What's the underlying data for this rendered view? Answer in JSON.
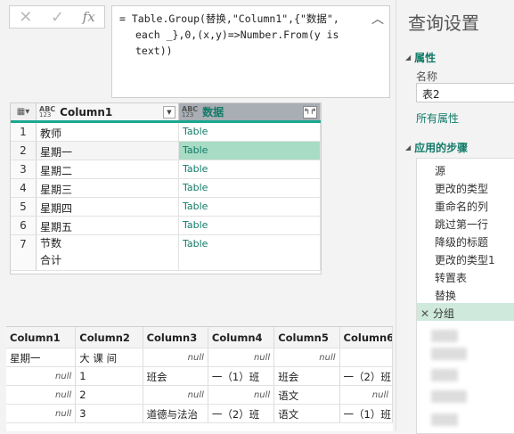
{
  "formula_bar": {
    "cancel_icon": "✕",
    "commit_icon": "✓",
    "fx_label": "fx",
    "line1": "= Table.Group(替换,\"Column1\",{\"数据\",",
    "line2": "each _},0,(x,y)=>Number.From(y is",
    "line3": "text))",
    "collapse_icon": "︿"
  },
  "grid1": {
    "type_icon_top": "ABC",
    "type_icon_bottom": "123",
    "col1": "Column1",
    "col2": "数据",
    "rows": [
      {
        "num": "1",
        "c1": "教师",
        "c2": "Table"
      },
      {
        "num": "2",
        "c1": "星期一",
        "c2": "Table"
      },
      {
        "num": "3",
        "c1": "星期二",
        "c2": "Table"
      },
      {
        "num": "4",
        "c1": "星期三",
        "c2": "Table"
      },
      {
        "num": "5",
        "c1": "星期四",
        "c2": "Table"
      },
      {
        "num": "6",
        "c1": "星期五",
        "c2": "Table"
      },
      {
        "num": "7",
        "c1a": "节数",
        "c1b": "合计",
        "c2": "Table"
      }
    ]
  },
  "grid2": {
    "headers": [
      "Column1",
      "Column2",
      "Column3",
      "Column4",
      "Column5",
      "Column6"
    ],
    "rows": [
      [
        "星期一",
        "大 课 间",
        "null",
        "null",
        "null",
        ""
      ],
      [
        "null",
        "1",
        "班会",
        "一（1）班",
        "班会",
        "一（2）班"
      ],
      [
        "null",
        "2",
        "null",
        "null",
        "语文",
        "null"
      ],
      [
        "null",
        "3",
        "道德与法治",
        "一（2）班",
        "语文",
        "一（1）班"
      ]
    ]
  },
  "query_settings": {
    "title": "查询设置",
    "properties": "属性",
    "name_label": "名称",
    "name_value": "表2",
    "all_properties": "所有属性",
    "applied_steps": "应用的步骤",
    "steps": [
      "源",
      "更改的类型",
      "重命名的列",
      "跳过第一行",
      "降级的标题",
      "更改的类型1",
      "转置表",
      "替换",
      "分组"
    ]
  }
}
